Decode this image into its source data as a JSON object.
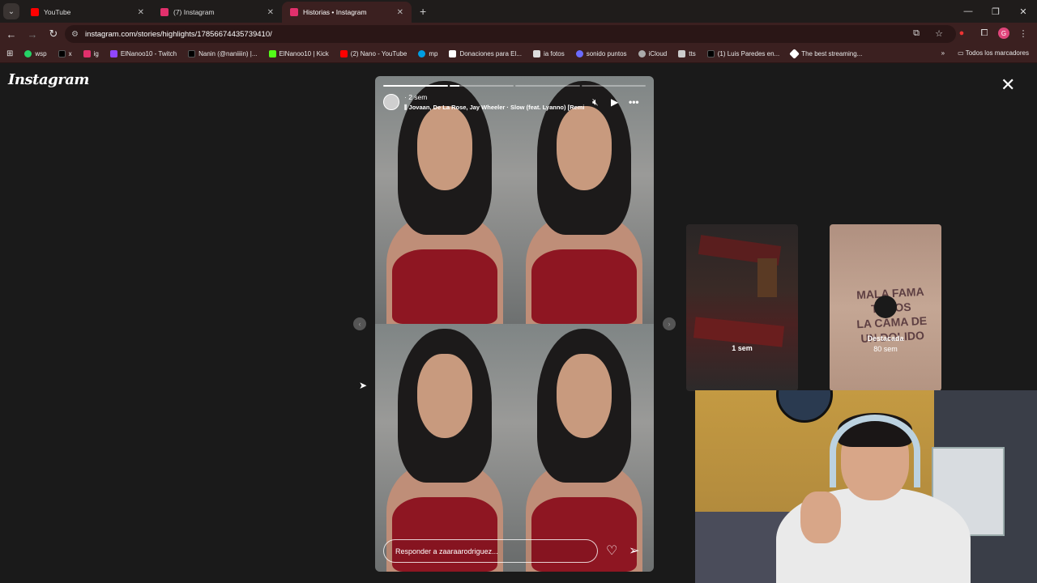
{
  "browser": {
    "tabs": [
      {
        "title": "YouTube",
        "color": "#ff0000",
        "active": false
      },
      {
        "title": "(7) Instagram",
        "color": "#e1306c",
        "active": false
      },
      {
        "title": "Historias • Instagram",
        "color": "#e1306c",
        "active": true
      }
    ],
    "url": "instagram.com/stories/highlights/17856674435739410/",
    "bookmarks": [
      {
        "label": "wsp",
        "color": "#25d366"
      },
      {
        "label": "x",
        "color": "#000000"
      },
      {
        "label": "ig",
        "color": "#e1306c"
      },
      {
        "label": "ElNanoo10 - Twitch",
        "color": "#9146ff"
      },
      {
        "label": "Nanin (@naniiiin) |...",
        "color": "#000000"
      },
      {
        "label": "ElNanoo10 | Kick",
        "color": "#53fc18"
      },
      {
        "label": "(2) Nano - YouTube",
        "color": "#ff0000"
      },
      {
        "label": "mp",
        "color": "#009ee3"
      },
      {
        "label": "Donaciones para El...",
        "color": "#ffffff"
      },
      {
        "label": "ia fotos",
        "color": "#dddddd"
      },
      {
        "label": "sonido puntos",
        "color": "#6b6bff"
      },
      {
        "label": "iCloud",
        "color": "#aaaaaa"
      },
      {
        "label": "tts",
        "color": "#cccccc"
      },
      {
        "label": "(1) Luis Paredes en...",
        "color": "#000000"
      },
      {
        "label": "The best streaming...",
        "color": "#ffffff"
      }
    ],
    "bookmarks_overflow": "»",
    "all_bookmarks": "Todos los marcadores",
    "profile_initial": "G"
  },
  "page": {
    "logo": "Instagram",
    "story": {
      "time_ago": "2 sem",
      "music": "Jovaan, De La Rose, Jay Wheeler · Slow (feat. Lyanno) [Remi",
      "reply_placeholder": "Responder a zaaraarodriguez...",
      "progress_segments": 4,
      "progress_done_fraction": 1.15
    },
    "previews": [
      {
        "label": "1 sem"
      },
      {
        "label_top": "Destacada",
        "label_bottom": "80 sem"
      }
    ],
    "accent_colors": {
      "lingerie": "#8e1622",
      "tab_active": "#3b2020"
    }
  }
}
